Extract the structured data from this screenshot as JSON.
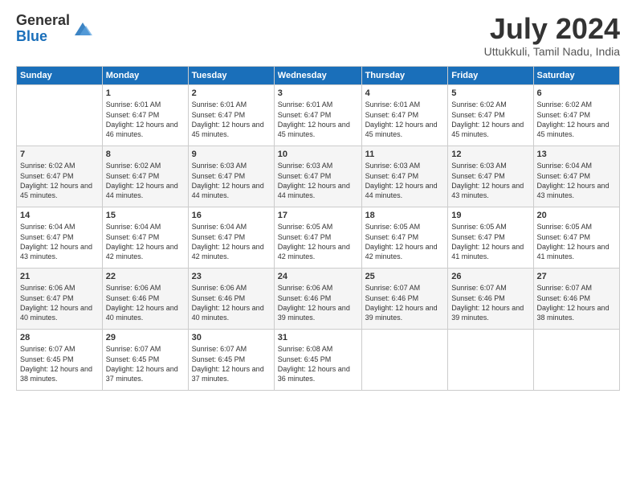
{
  "logo": {
    "general": "General",
    "blue": "Blue"
  },
  "title": "July 2024",
  "location": "Uttukkuli, Tamil Nadu, India",
  "headers": [
    "Sunday",
    "Monday",
    "Tuesday",
    "Wednesday",
    "Thursday",
    "Friday",
    "Saturday"
  ],
  "weeks": [
    [
      {
        "day": "",
        "sunrise": "",
        "sunset": "",
        "daylight": ""
      },
      {
        "day": "1",
        "sunrise": "Sunrise: 6:01 AM",
        "sunset": "Sunset: 6:47 PM",
        "daylight": "Daylight: 12 hours and 46 minutes."
      },
      {
        "day": "2",
        "sunrise": "Sunrise: 6:01 AM",
        "sunset": "Sunset: 6:47 PM",
        "daylight": "Daylight: 12 hours and 45 minutes."
      },
      {
        "day": "3",
        "sunrise": "Sunrise: 6:01 AM",
        "sunset": "Sunset: 6:47 PM",
        "daylight": "Daylight: 12 hours and 45 minutes."
      },
      {
        "day": "4",
        "sunrise": "Sunrise: 6:01 AM",
        "sunset": "Sunset: 6:47 PM",
        "daylight": "Daylight: 12 hours and 45 minutes."
      },
      {
        "day": "5",
        "sunrise": "Sunrise: 6:02 AM",
        "sunset": "Sunset: 6:47 PM",
        "daylight": "Daylight: 12 hours and 45 minutes."
      },
      {
        "day": "6",
        "sunrise": "Sunrise: 6:02 AM",
        "sunset": "Sunset: 6:47 PM",
        "daylight": "Daylight: 12 hours and 45 minutes."
      }
    ],
    [
      {
        "day": "7",
        "sunrise": "Sunrise: 6:02 AM",
        "sunset": "Sunset: 6:47 PM",
        "daylight": "Daylight: 12 hours and 45 minutes."
      },
      {
        "day": "8",
        "sunrise": "Sunrise: 6:02 AM",
        "sunset": "Sunset: 6:47 PM",
        "daylight": "Daylight: 12 hours and 44 minutes."
      },
      {
        "day": "9",
        "sunrise": "Sunrise: 6:03 AM",
        "sunset": "Sunset: 6:47 PM",
        "daylight": "Daylight: 12 hours and 44 minutes."
      },
      {
        "day": "10",
        "sunrise": "Sunrise: 6:03 AM",
        "sunset": "Sunset: 6:47 PM",
        "daylight": "Daylight: 12 hours and 44 minutes."
      },
      {
        "day": "11",
        "sunrise": "Sunrise: 6:03 AM",
        "sunset": "Sunset: 6:47 PM",
        "daylight": "Daylight: 12 hours and 44 minutes."
      },
      {
        "day": "12",
        "sunrise": "Sunrise: 6:03 AM",
        "sunset": "Sunset: 6:47 PM",
        "daylight": "Daylight: 12 hours and 43 minutes."
      },
      {
        "day": "13",
        "sunrise": "Sunrise: 6:04 AM",
        "sunset": "Sunset: 6:47 PM",
        "daylight": "Daylight: 12 hours and 43 minutes."
      }
    ],
    [
      {
        "day": "14",
        "sunrise": "Sunrise: 6:04 AM",
        "sunset": "Sunset: 6:47 PM",
        "daylight": "Daylight: 12 hours and 43 minutes."
      },
      {
        "day": "15",
        "sunrise": "Sunrise: 6:04 AM",
        "sunset": "Sunset: 6:47 PM",
        "daylight": "Daylight: 12 hours and 42 minutes."
      },
      {
        "day": "16",
        "sunrise": "Sunrise: 6:04 AM",
        "sunset": "Sunset: 6:47 PM",
        "daylight": "Daylight: 12 hours and 42 minutes."
      },
      {
        "day": "17",
        "sunrise": "Sunrise: 6:05 AM",
        "sunset": "Sunset: 6:47 PM",
        "daylight": "Daylight: 12 hours and 42 minutes."
      },
      {
        "day": "18",
        "sunrise": "Sunrise: 6:05 AM",
        "sunset": "Sunset: 6:47 PM",
        "daylight": "Daylight: 12 hours and 42 minutes."
      },
      {
        "day": "19",
        "sunrise": "Sunrise: 6:05 AM",
        "sunset": "Sunset: 6:47 PM",
        "daylight": "Daylight: 12 hours and 41 minutes."
      },
      {
        "day": "20",
        "sunrise": "Sunrise: 6:05 AM",
        "sunset": "Sunset: 6:47 PM",
        "daylight": "Daylight: 12 hours and 41 minutes."
      }
    ],
    [
      {
        "day": "21",
        "sunrise": "Sunrise: 6:06 AM",
        "sunset": "Sunset: 6:47 PM",
        "daylight": "Daylight: 12 hours and 40 minutes."
      },
      {
        "day": "22",
        "sunrise": "Sunrise: 6:06 AM",
        "sunset": "Sunset: 6:46 PM",
        "daylight": "Daylight: 12 hours and 40 minutes."
      },
      {
        "day": "23",
        "sunrise": "Sunrise: 6:06 AM",
        "sunset": "Sunset: 6:46 PM",
        "daylight": "Daylight: 12 hours and 40 minutes."
      },
      {
        "day": "24",
        "sunrise": "Sunrise: 6:06 AM",
        "sunset": "Sunset: 6:46 PM",
        "daylight": "Daylight: 12 hours and 39 minutes."
      },
      {
        "day": "25",
        "sunrise": "Sunrise: 6:07 AM",
        "sunset": "Sunset: 6:46 PM",
        "daylight": "Daylight: 12 hours and 39 minutes."
      },
      {
        "day": "26",
        "sunrise": "Sunrise: 6:07 AM",
        "sunset": "Sunset: 6:46 PM",
        "daylight": "Daylight: 12 hours and 39 minutes."
      },
      {
        "day": "27",
        "sunrise": "Sunrise: 6:07 AM",
        "sunset": "Sunset: 6:46 PM",
        "daylight": "Daylight: 12 hours and 38 minutes."
      }
    ],
    [
      {
        "day": "28",
        "sunrise": "Sunrise: 6:07 AM",
        "sunset": "Sunset: 6:45 PM",
        "daylight": "Daylight: 12 hours and 38 minutes."
      },
      {
        "day": "29",
        "sunrise": "Sunrise: 6:07 AM",
        "sunset": "Sunset: 6:45 PM",
        "daylight": "Daylight: 12 hours and 37 minutes."
      },
      {
        "day": "30",
        "sunrise": "Sunrise: 6:07 AM",
        "sunset": "Sunset: 6:45 PM",
        "daylight": "Daylight: 12 hours and 37 minutes."
      },
      {
        "day": "31",
        "sunrise": "Sunrise: 6:08 AM",
        "sunset": "Sunset: 6:45 PM",
        "daylight": "Daylight: 12 hours and 36 minutes."
      },
      {
        "day": "",
        "sunrise": "",
        "sunset": "",
        "daylight": ""
      },
      {
        "day": "",
        "sunrise": "",
        "sunset": "",
        "daylight": ""
      },
      {
        "day": "",
        "sunrise": "",
        "sunset": "",
        "daylight": ""
      }
    ]
  ]
}
